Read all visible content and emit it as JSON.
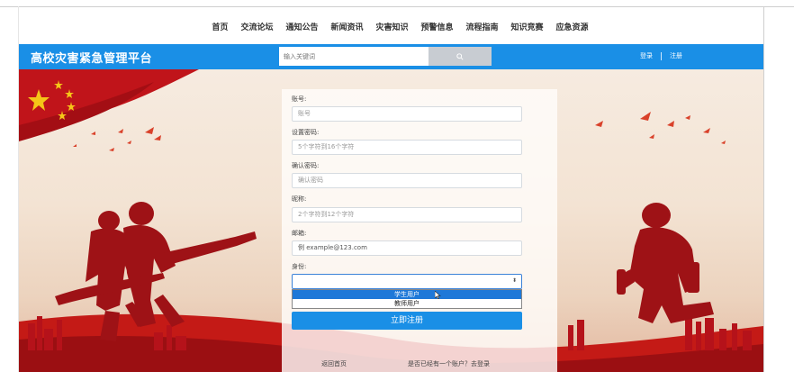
{
  "nav": {
    "items": [
      "首页",
      "交流论坛",
      "通知公告",
      "新闻资讯",
      "灾害知识",
      "预警信息",
      "流程指南",
      "知识竞赛",
      "应急资源"
    ]
  },
  "header": {
    "site_title": "高校灾害紧急管理平台",
    "search_placeholder": "输入关键词",
    "login_label": "登录",
    "register_label": "注册"
  },
  "form": {
    "account_label": "账号:",
    "account_placeholder": "账号",
    "password_label": "设置密码:",
    "password_placeholder": "5个字符到16个字符",
    "confirm_label": "确认密码:",
    "confirm_placeholder": "确认密码",
    "nickname_label": "昵称:",
    "nickname_placeholder": "2个字符到12个字符",
    "email_label": "邮箱:",
    "email_placeholder": "例 example@123.com",
    "role_label": "身份:",
    "role_options": [
      "学生用户",
      "教师用户"
    ],
    "submit_label": "立即注册",
    "back_home_link": "返回首页",
    "login_link": "是否已经有一个账户？去登录"
  },
  "colors": {
    "accent": "#1a8fe6",
    "dropdown_selected": "#1e78d8",
    "search_button": "#c8ccd2"
  },
  "icons": [
    "search-icon",
    "chevron-updown-icon",
    "mouse-cursor-icon"
  ]
}
